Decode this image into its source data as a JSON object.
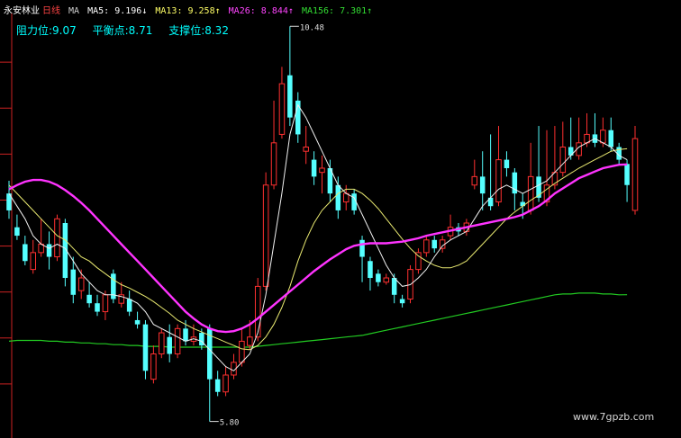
{
  "header": {
    "stock_name": "永安林业",
    "period": "日线",
    "ma_label": "MA",
    "indicators": [
      {
        "text": "MA5: 9.196↓",
        "color": "#ffffff"
      },
      {
        "text": "MA13: 9.258↑",
        "color": "#ffff66"
      },
      {
        "text": "MA26: 8.844↑",
        "color": "#ff44ff"
      },
      {
        "text": "MA156: 7.301↑",
        "color": "#33dd33"
      }
    ]
  },
  "levels": {
    "resistance": "阻力位:9.07",
    "balance": "平衡点:8.71",
    "support": "支撑位:8.32"
  },
  "watermark": "www.7gpzb.com",
  "colors": {
    "up": "#ff3030",
    "down": "#55ffff",
    "ma5": "#f0f0f0",
    "ma13": "#e8e870",
    "ma26": "#ff33ff",
    "ma156": "#22cc22",
    "axis": "#cc2222",
    "header_text": "#cfcfcf",
    "title": "#ff4444",
    "levels": "#00ffff"
  },
  "chart_data": {
    "type": "candlestick",
    "high_label": "10.48",
    "low_label": "5.80",
    "price_range": [
      5.7,
      10.6
    ],
    "candles": [
      {
        "o": 8.5,
        "c": 8.3,
        "h": 8.65,
        "l": 8.2
      },
      {
        "o": 8.1,
        "c": 8.0,
        "h": 8.25,
        "l": 7.95
      },
      {
        "o": 7.9,
        "c": 7.7,
        "h": 8.0,
        "l": 7.65
      },
      {
        "o": 7.6,
        "c": 7.8,
        "h": 7.95,
        "l": 7.55
      },
      {
        "o": 7.8,
        "c": 7.9,
        "h": 8.2,
        "l": 7.75
      },
      {
        "o": 7.9,
        "c": 7.75,
        "h": 8.05,
        "l": 7.6
      },
      {
        "o": 7.75,
        "c": 8.2,
        "h": 8.25,
        "l": 7.7
      },
      {
        "o": 8.15,
        "c": 7.5,
        "h": 8.2,
        "l": 7.4
      },
      {
        "o": 7.6,
        "c": 7.3,
        "h": 7.75,
        "l": 7.2
      },
      {
        "o": 7.35,
        "c": 7.5,
        "h": 7.6,
        "l": 7.25
      },
      {
        "o": 7.3,
        "c": 7.2,
        "h": 7.45,
        "l": 7.15
      },
      {
        "o": 7.2,
        "c": 7.1,
        "h": 7.3,
        "l": 7.05
      },
      {
        "o": 7.1,
        "c": 7.3,
        "h": 7.35,
        "l": 7.0
      },
      {
        "o": 7.55,
        "c": 7.25,
        "h": 7.6,
        "l": 7.2
      },
      {
        "o": 7.2,
        "c": 7.3,
        "h": 7.45,
        "l": 7.15
      },
      {
        "o": 7.25,
        "c": 7.1,
        "h": 7.35,
        "l": 7.05
      },
      {
        "o": 7.0,
        "c": 6.95,
        "h": 7.1,
        "l": 6.9
      },
      {
        "o": 6.95,
        "c": 6.4,
        "h": 7.0,
        "l": 6.3
      },
      {
        "o": 6.3,
        "c": 6.6,
        "h": 6.7,
        "l": 6.25
      },
      {
        "o": 6.6,
        "c": 6.85,
        "h": 6.9,
        "l": 6.55
      },
      {
        "o": 6.8,
        "c": 6.6,
        "h": 6.95,
        "l": 6.5
      },
      {
        "o": 6.6,
        "c": 6.9,
        "h": 6.95,
        "l": 6.55
      },
      {
        "o": 6.9,
        "c": 6.75,
        "h": 7.0,
        "l": 6.7
      },
      {
        "o": 6.75,
        "c": 6.8,
        "h": 6.95,
        "l": 6.7
      },
      {
        "o": 6.85,
        "c": 6.7,
        "h": 6.9,
        "l": 6.65
      },
      {
        "o": 6.9,
        "c": 6.3,
        "h": 6.95,
        "l": 5.8
      },
      {
        "o": 6.3,
        "c": 6.15,
        "h": 6.4,
        "l": 6.1
      },
      {
        "o": 6.15,
        "c": 6.35,
        "h": 6.45,
        "l": 6.1
      },
      {
        "o": 6.35,
        "c": 6.5,
        "h": 6.6,
        "l": 6.3
      },
      {
        "o": 6.5,
        "c": 6.75,
        "h": 6.9,
        "l": 6.45
      },
      {
        "o": 6.7,
        "c": 6.8,
        "h": 7.0,
        "l": 6.65
      },
      {
        "o": 6.8,
        "c": 7.4,
        "h": 7.5,
        "l": 6.75
      },
      {
        "o": 7.4,
        "c": 8.6,
        "h": 8.75,
        "l": 7.35
      },
      {
        "o": 8.6,
        "c": 9.1,
        "h": 9.6,
        "l": 8.55
      },
      {
        "o": 9.2,
        "c": 9.8,
        "h": 10.0,
        "l": 9.15
      },
      {
        "o": 9.9,
        "c": 9.4,
        "h": 10.48,
        "l": 9.3
      },
      {
        "o": 9.6,
        "c": 9.2,
        "h": 9.7,
        "l": 9.1
      },
      {
        "o": 9.0,
        "c": 9.05,
        "h": 9.3,
        "l": 8.85
      },
      {
        "o": 8.9,
        "c": 8.7,
        "h": 9.0,
        "l": 8.6
      },
      {
        "o": 8.75,
        "c": 8.8,
        "h": 8.95,
        "l": 8.5
      },
      {
        "o": 8.8,
        "c": 8.5,
        "h": 8.9,
        "l": 8.4
      },
      {
        "o": 8.6,
        "c": 8.3,
        "h": 8.7,
        "l": 8.2
      },
      {
        "o": 8.4,
        "c": 8.5,
        "h": 8.6,
        "l": 8.3
      },
      {
        "o": 8.5,
        "c": 8.3,
        "h": 8.55,
        "l": 8.25
      },
      {
        "o": 7.95,
        "c": 7.75,
        "h": 8.0,
        "l": 7.45
      },
      {
        "o": 7.7,
        "c": 7.5,
        "h": 7.75,
        "l": 7.35
      },
      {
        "o": 7.55,
        "c": 7.45,
        "h": 7.6,
        "l": 7.4
      },
      {
        "o": 7.45,
        "c": 7.5,
        "h": 7.55,
        "l": 7.42
      },
      {
        "o": 7.5,
        "c": 7.3,
        "h": 7.55,
        "l": 7.2
      },
      {
        "o": 7.25,
        "c": 7.2,
        "h": 7.3,
        "l": 7.15
      },
      {
        "o": 7.25,
        "c": 7.6,
        "h": 7.65,
        "l": 7.2
      },
      {
        "o": 7.6,
        "c": 7.8,
        "h": 7.85,
        "l": 7.55
      },
      {
        "o": 7.8,
        "c": 7.95,
        "h": 8.0,
        "l": 7.75
      },
      {
        "o": 7.95,
        "c": 7.85,
        "h": 8.0,
        "l": 7.8
      },
      {
        "o": 7.85,
        "c": 7.95,
        "h": 8.0,
        "l": 7.8
      },
      {
        "o": 8.0,
        "c": 8.1,
        "h": 8.25,
        "l": 7.95
      },
      {
        "o": 8.1,
        "c": 8.05,
        "h": 8.15,
        "l": 8.0
      },
      {
        "o": 8.05,
        "c": 8.15,
        "h": 8.2,
        "l": 8.0
      },
      {
        "o": 8.6,
        "c": 8.7,
        "h": 8.9,
        "l": 8.55
      },
      {
        "o": 8.7,
        "c": 8.5,
        "h": 9.0,
        "l": 8.3
      },
      {
        "o": 8.45,
        "c": 8.35,
        "h": 9.2,
        "l": 8.3
      },
      {
        "o": 8.4,
        "c": 8.9,
        "h": 9.3,
        "l": 8.35
      },
      {
        "o": 8.9,
        "c": 8.8,
        "h": 9.0,
        "l": 8.7
      },
      {
        "o": 8.75,
        "c": 8.5,
        "h": 8.8,
        "l": 8.3
      },
      {
        "o": 8.4,
        "c": 8.35,
        "h": 8.5,
        "l": 8.2
      },
      {
        "o": 8.3,
        "c": 8.7,
        "h": 9.1,
        "l": 8.25
      },
      {
        "o": 8.7,
        "c": 8.45,
        "h": 9.3,
        "l": 8.4
      },
      {
        "o": 8.4,
        "c": 8.6,
        "h": 9.25,
        "l": 8.35
      },
      {
        "o": 8.6,
        "c": 8.75,
        "h": 9.3,
        "l": 8.55
      },
      {
        "o": 8.75,
        "c": 9.05,
        "h": 9.35,
        "l": 8.7
      },
      {
        "o": 9.05,
        "c": 8.95,
        "h": 9.4,
        "l": 8.9
      },
      {
        "o": 8.95,
        "c": 9.1,
        "h": 9.4,
        "l": 8.9
      },
      {
        "o": 9.1,
        "c": 9.2,
        "h": 9.45,
        "l": 9.05
      },
      {
        "o": 9.2,
        "c": 9.1,
        "h": 9.45,
        "l": 9.05
      },
      {
        "o": 9.1,
        "c": 9.25,
        "h": 9.4,
        "l": 9.05
      },
      {
        "o": 9.25,
        "c": 9.05,
        "h": 9.4,
        "l": 9.0
      },
      {
        "o": 9.05,
        "c": 8.9,
        "h": 9.1,
        "l": 8.85
      },
      {
        "o": 8.85,
        "c": 8.6,
        "h": 8.9,
        "l": 8.4
      },
      {
        "o": 8.3,
        "c": 9.15,
        "h": 9.3,
        "l": 8.25
      }
    ],
    "ma5": [
      8.5,
      8.35,
      8.2,
      8.0,
      7.9,
      7.85,
      7.9,
      7.85,
      7.7,
      7.55,
      7.45,
      7.35,
      7.3,
      7.3,
      7.28,
      7.25,
      7.2,
      7.1,
      6.95,
      6.9,
      6.85,
      6.8,
      6.75,
      6.78,
      6.75,
      6.65,
      6.55,
      6.45,
      6.4,
      6.5,
      6.6,
      6.85,
      7.3,
      7.9,
      8.5,
      9.2,
      9.55,
      9.4,
      9.2,
      9.0,
      8.8,
      8.6,
      8.5,
      8.45,
      8.25,
      8.05,
      7.85,
      7.65,
      7.5,
      7.4,
      7.42,
      7.5,
      7.6,
      7.75,
      7.88,
      7.95,
      8.0,
      8.05,
      8.2,
      8.35,
      8.45,
      8.55,
      8.6,
      8.55,
      8.5,
      8.55,
      8.6,
      8.65,
      8.75,
      8.85,
      8.95,
      9.05,
      9.1,
      9.15,
      9.1,
      9.05,
      8.95,
      8.9
    ],
    "ma13": [
      8.6,
      8.5,
      8.4,
      8.3,
      8.2,
      8.1,
      8.0,
      7.95,
      7.85,
      7.75,
      7.7,
      7.62,
      7.55,
      7.48,
      7.42,
      7.38,
      7.33,
      7.28,
      7.22,
      7.15,
      7.08,
      7.0,
      6.95,
      6.9,
      6.86,
      6.82,
      6.78,
      6.74,
      6.7,
      6.66,
      6.65,
      6.7,
      6.8,
      6.95,
      7.15,
      7.4,
      7.7,
      7.95,
      8.15,
      8.3,
      8.4,
      8.5,
      8.55,
      8.55,
      8.5,
      8.42,
      8.32,
      8.2,
      8.08,
      7.96,
      7.85,
      7.76,
      7.7,
      7.65,
      7.62,
      7.62,
      7.65,
      7.7,
      7.8,
      7.9,
      8.0,
      8.1,
      8.2,
      8.28,
      8.35,
      8.42,
      8.48,
      8.55,
      8.62,
      8.68,
      8.74,
      8.8,
      8.85,
      8.9,
      8.95,
      9.0,
      9.02,
      9.03
    ],
    "ma26": [
      8.55,
      8.6,
      8.64,
      8.66,
      8.66,
      8.64,
      8.6,
      8.54,
      8.47,
      8.39,
      8.3,
      8.2,
      8.1,
      8.0,
      7.9,
      7.8,
      7.7,
      7.6,
      7.5,
      7.4,
      7.3,
      7.2,
      7.1,
      7.02,
      6.95,
      6.9,
      6.87,
      6.86,
      6.87,
      6.9,
      6.95,
      7.02,
      7.1,
      7.18,
      7.26,
      7.34,
      7.42,
      7.5,
      7.58,
      7.65,
      7.72,
      7.78,
      7.84,
      7.88,
      7.9,
      7.91,
      7.91,
      7.91,
      7.92,
      7.93,
      7.95,
      7.97,
      8.0,
      8.02,
      8.04,
      8.06,
      8.08,
      8.1,
      8.12,
      8.14,
      8.16,
      8.18,
      8.2,
      8.22,
      8.25,
      8.3,
      8.35,
      8.42,
      8.5,
      8.56,
      8.62,
      8.68,
      8.72,
      8.76,
      8.8,
      8.82,
      8.84,
      8.844
    ],
    "ma156": [
      6.75,
      6.76,
      6.76,
      6.76,
      6.76,
      6.75,
      6.75,
      6.74,
      6.74,
      6.73,
      6.73,
      6.72,
      6.72,
      6.71,
      6.71,
      6.7,
      6.7,
      6.69,
      6.69,
      6.69,
      6.68,
      6.68,
      6.68,
      6.68,
      6.68,
      6.68,
      6.68,
      6.68,
      6.68,
      6.68,
      6.68,
      6.69,
      6.7,
      6.71,
      6.72,
      6.73,
      6.74,
      6.75,
      6.76,
      6.77,
      6.78,
      6.79,
      6.8,
      6.81,
      6.82,
      6.84,
      6.86,
      6.88,
      6.9,
      6.92,
      6.94,
      6.96,
      6.98,
      7.0,
      7.02,
      7.04,
      7.06,
      7.08,
      7.1,
      7.12,
      7.14,
      7.16,
      7.18,
      7.2,
      7.22,
      7.24,
      7.26,
      7.28,
      7.3,
      7.31,
      7.31,
      7.32,
      7.32,
      7.32,
      7.31,
      7.31,
      7.3,
      7.301
    ]
  }
}
